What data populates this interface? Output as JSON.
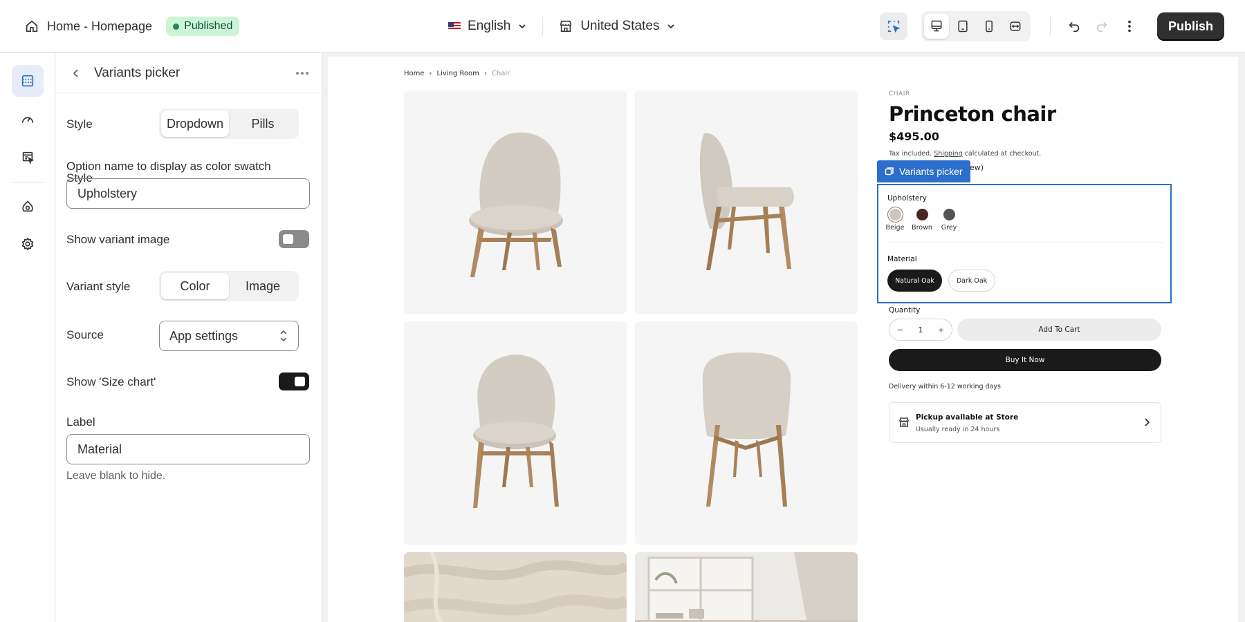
{
  "topbar": {
    "page_title": "Home - Homepage",
    "status_badge": "Published",
    "language": "English",
    "country": "United States",
    "publish_label": "Publish"
  },
  "panel": {
    "title": "Variants picker",
    "style_label": "Style",
    "style_options": [
      "Dropdown",
      "Pills"
    ],
    "style_selected": "Dropdown",
    "swatch_option_label": "Option name to display as color swatch",
    "swatch_option_value": "Upholstery",
    "show_variant_image_label": "Show variant image",
    "show_variant_image": false,
    "variant_style_label": "Variant style",
    "variant_style_options": [
      "Color",
      "Image"
    ],
    "variant_style_selected": "Color",
    "source_label": "Source",
    "source_value": "App settings",
    "size_chart_label": "Show 'Size chart'",
    "size_chart": true,
    "label_label": "Label",
    "label_value": "Material",
    "label_help": "Leave blank to hide."
  },
  "preview": {
    "breadcrumb": [
      "Home",
      "Living Room",
      "Chair"
    ],
    "category": "CHAIR",
    "product_name": "Princeton chair",
    "price": "$495.00",
    "tax_prefix": "Tax included.",
    "tax_link": "Shipping",
    "tax_suffix": "calculated at checkout.",
    "partial_text": "ew)",
    "selection_tag": "Variants picker",
    "upholstery_label": "Upholstery",
    "swatches": [
      {
        "name": "Beige",
        "color": "#cfc6bb"
      },
      {
        "name": "Brown",
        "color": "#4a2420"
      },
      {
        "name": "Grey",
        "color": "#545454"
      }
    ],
    "material_label": "Material",
    "materials": [
      "Natural Oak",
      "Dark Oak"
    ],
    "material_selected": "Natural Oak",
    "quantity_label": "Quantity",
    "quantity_value": "1",
    "add_to_cart": "Add To Cart",
    "buy_now": "Buy It Now",
    "delivery": "Delivery within 6-12 working days",
    "pickup_title": "Pickup available at Store",
    "pickup_sub": "Usually ready in 24 hours"
  },
  "colors": {
    "accent": "#2c6ecb",
    "published_bg": "#cdf4d6",
    "published_dot": "#29845a",
    "primary_dark": "#303030"
  }
}
